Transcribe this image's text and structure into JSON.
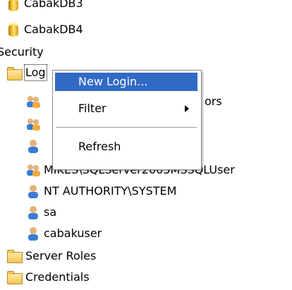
{
  "tree": {
    "db_top_partial": "CabakDB3",
    "db_item": "CabakDB4",
    "security": "Security",
    "logins": "Logins",
    "logins_visible": "Log",
    "user_partial_1": "ors",
    "login_items": [
      "MIKES\\SQLServer2005MSSQLUser",
      "NT AUTHORITY\\SYSTEM",
      "sa",
      "cabakuser"
    ],
    "server_roles": "Server Roles",
    "credentials": "Credentials"
  },
  "context_menu": {
    "items": [
      {
        "label": "New Login...",
        "highlighted": true
      },
      {
        "label": "Filter",
        "has_submenu": true
      },
      {
        "label": "Refresh"
      }
    ],
    "highlight_color": "#316ac5"
  }
}
